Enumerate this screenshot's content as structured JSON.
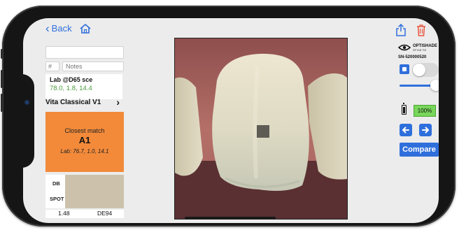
{
  "nav": {
    "back_label": "Back"
  },
  "inputs": {
    "name_value": "",
    "number_placeholder": "#",
    "notes_placeholder": "Notes"
  },
  "lab": {
    "title": "Lab @D65 sce",
    "values": "78.0, 1.8, 14.4"
  },
  "shade_guide": {
    "label": "Vita Classical V1",
    "chevron": "›"
  },
  "closest_match": {
    "heading": "Closest match",
    "shade": "A1",
    "lab_text": "Lab: 76.7, 1.0, 14.1"
  },
  "comparison": {
    "db_label": "DB",
    "spot_label": "SPOT",
    "de_value": "1.48",
    "de_label": "DE94"
  },
  "device": {
    "brand": "OPTISHADE",
    "sub_brand": "STYLE TO",
    "serial": "SN-520000520",
    "battery_percent_label": "100%",
    "battery_level": 1.0
  },
  "actions": {
    "compare_label": "Compare"
  },
  "colors": {
    "accent": "#2f6fdc",
    "match_bg": "#f28a3a",
    "lab_value_green": "#4b9a3a",
    "battery_green": "#78d65a",
    "swatch": "#ccc2ac"
  },
  "icons": [
    "chevron-left-icon",
    "home-icon",
    "share-icon",
    "trash-icon",
    "eye-logo-icon",
    "camera-icon",
    "battery-icon",
    "arrow-left-icon",
    "arrow-right-icon"
  ]
}
